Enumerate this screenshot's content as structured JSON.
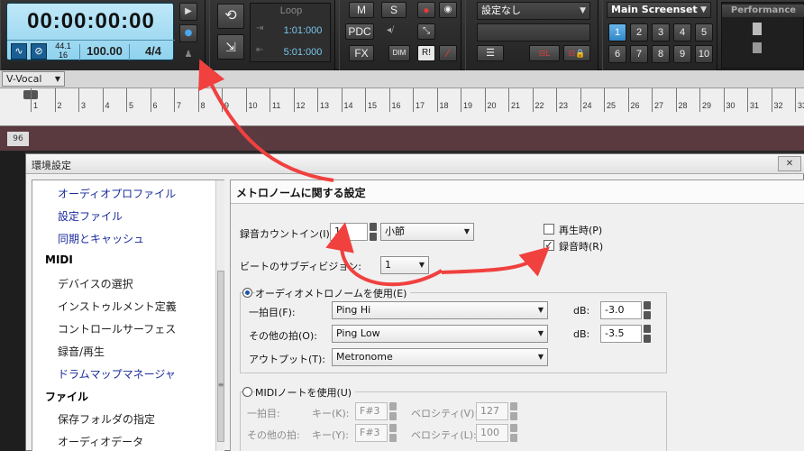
{
  "transport": {
    "time": "00:00:00:00",
    "sample_rate": "44.1",
    "bit_depth": "16",
    "tempo": "100.00",
    "meter": "4/4"
  },
  "loop": {
    "title": "Loop",
    "start": "1:01:000",
    "end": "5:01:000"
  },
  "mix": {
    "m_label": "M",
    "s_label": "S",
    "pdc_label": "PDC",
    "fx_label": "FX",
    "dim_label": "DIM",
    "r_label": "R!"
  },
  "preset": {
    "value": "設定なし"
  },
  "screenset": {
    "title": "Main Screenset",
    "numbers": [
      "1",
      "2",
      "3",
      "4",
      "5",
      "6",
      "7",
      "8",
      "9",
      "10"
    ],
    "active": "1"
  },
  "performance": {
    "title": "Performance"
  },
  "track": {
    "name": "V-Vocal",
    "number": "96",
    "ruler_ticks": [
      "1",
      "2",
      "3",
      "4",
      "5",
      "6",
      "7",
      "8",
      "9",
      "10",
      "11",
      "12",
      "13",
      "14",
      "15",
      "16",
      "17",
      "18",
      "19",
      "20",
      "21",
      "22",
      "23",
      "24",
      "25",
      "26",
      "27",
      "28",
      "29",
      "30",
      "31",
      "32",
      "33"
    ]
  },
  "dialog": {
    "title": "環境設定",
    "close_label": "✕",
    "tree": [
      {
        "label": "オーディオプロファイル",
        "kind": "link"
      },
      {
        "label": "設定ファイル",
        "kind": "link"
      },
      {
        "label": "同期とキャッシュ",
        "kind": "link"
      },
      {
        "label": "MIDI",
        "kind": "cat"
      },
      {
        "label": "デバイスの選択",
        "kind": "plain"
      },
      {
        "label": "インストゥルメント定義",
        "kind": "plain"
      },
      {
        "label": "コントロールサーフェス",
        "kind": "plain"
      },
      {
        "label": "録音/再生",
        "kind": "plain"
      },
      {
        "label": "ドラムマップマネージャ",
        "kind": "link"
      },
      {
        "label": "ファイル",
        "kind": "cat"
      },
      {
        "label": "保存フォルダの指定",
        "kind": "plain"
      },
      {
        "label": "オーディオデータ",
        "kind": "plain"
      }
    ],
    "panel": {
      "header": "メトロノームに関する設定",
      "count_in_label": "録音カウントイン(I):",
      "count_in_value": "1",
      "count_in_unit": "小節",
      "playback_label": "再生時(P)",
      "recording_label": "録音時(R)",
      "beat_sub_label": "ビートのサブディビジョン:",
      "beat_sub_value": "1",
      "audio_radio_label": "オーディオメトロノームを使用(E)",
      "first_beat_label": "一拍目(F):",
      "first_beat_value": "Ping Hi",
      "first_db_label": "dB:",
      "first_db_value": "-3.0",
      "other_beat_label": "その他の拍(O):",
      "other_beat_value": "Ping Low",
      "other_db_label": "dB:",
      "other_db_value": "-3.5",
      "output_label": "アウトプット(T):",
      "output_value": "Metronome",
      "midi_radio_label": "MIDIノートを使用(U)",
      "midi_first_label": "一拍目:",
      "midi_key_label": "キー(K):",
      "midi_key_value": "F#3",
      "midi_vel_label": "ベロシティ(V):",
      "midi_vel_value": "127",
      "midi_other_label": "その他の拍:",
      "midi_key2_label": "キー(Y):",
      "midi_key2_value": "F#3",
      "midi_vel2_label": "ベロシティ(L):",
      "midi_vel2_value": "100"
    }
  },
  "colors": {
    "annotation_arrow": "#f0413f",
    "transport_display": "#a6ddf3",
    "screenset_active": "#3b93d6",
    "tree_link": "#1a2c9a"
  }
}
